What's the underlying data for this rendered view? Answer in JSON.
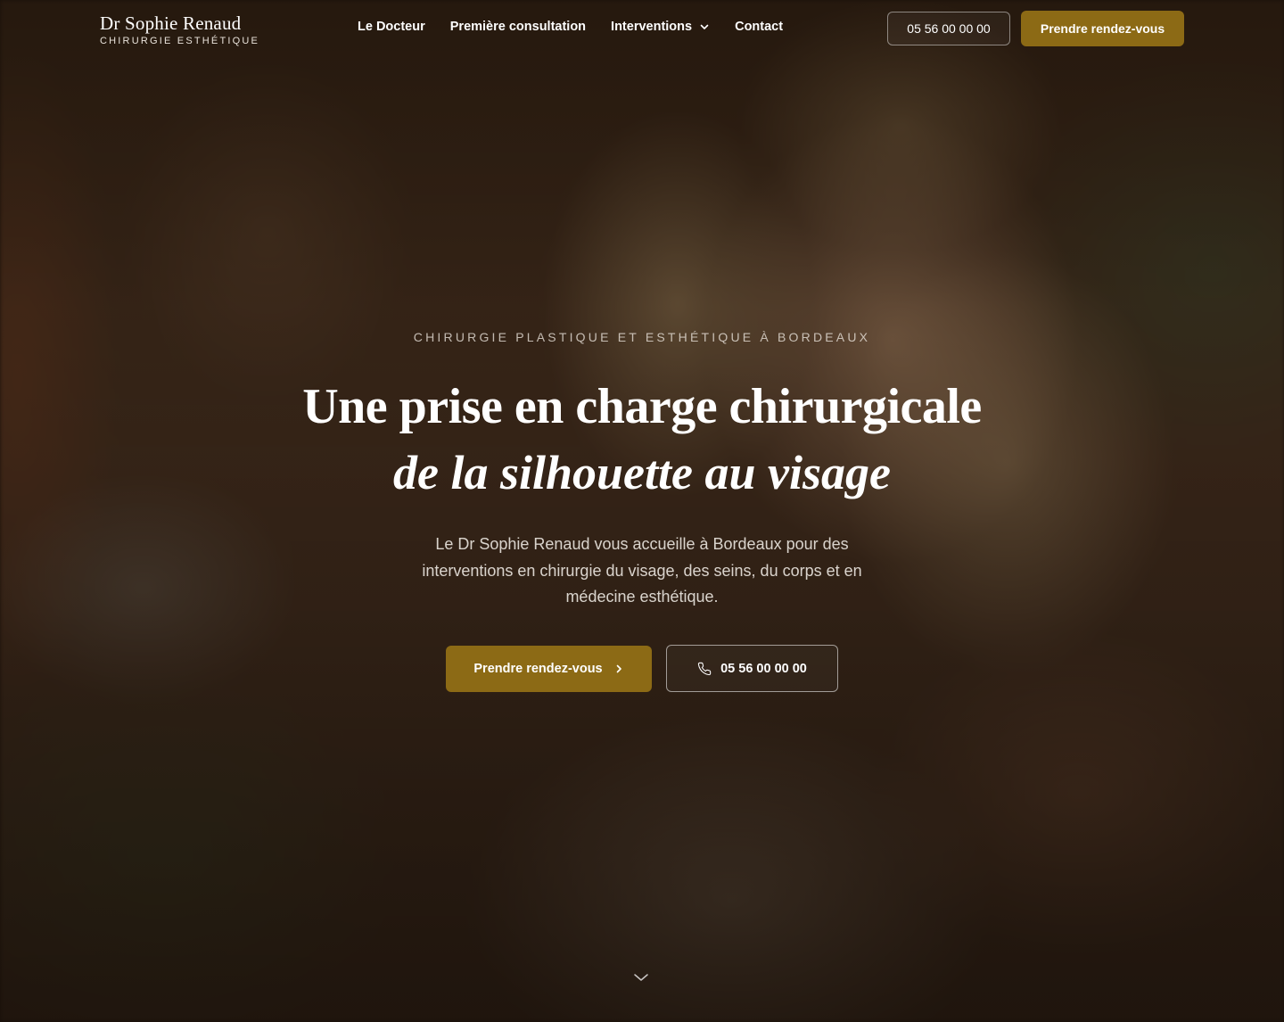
{
  "brand": {
    "name": "Dr Sophie Renaud",
    "tagline": "CHIRURGIE ESTHÉTIQUE"
  },
  "nav": {
    "items": [
      {
        "label": "Le Docteur"
      },
      {
        "label": "Première consultation"
      },
      {
        "label": "Interventions",
        "icon": "chevron-down-icon"
      },
      {
        "label": "Contact"
      }
    ]
  },
  "header": {
    "phone_label": "05 56 00 00 00",
    "cta_label": "Prendre rendez-vous"
  },
  "hero": {
    "eyebrow": "CHIRURGIE PLASTIQUE ET ESTHÉTIQUE À BORDEAUX",
    "headline_line1": "Une prise en charge chirurgicale",
    "headline_line2": "de la silhouette au visage",
    "lead": "Le Dr Sophie Renaud vous accueille à Bordeaux pour des interventions en chirurgie du visage, des seins, du corps et en médecine esthétique.",
    "primary_button": {
      "label": "Prendre rendez-vous",
      "icon": "chevron-right-icon"
    },
    "secondary_button": {
      "label": "05 56 00 00 00",
      "icon": "phone-icon"
    },
    "scroll_icon": "chevron-down-icon"
  },
  "colors": {
    "accent": "#8c6a15",
    "text": "#ffffff"
  }
}
